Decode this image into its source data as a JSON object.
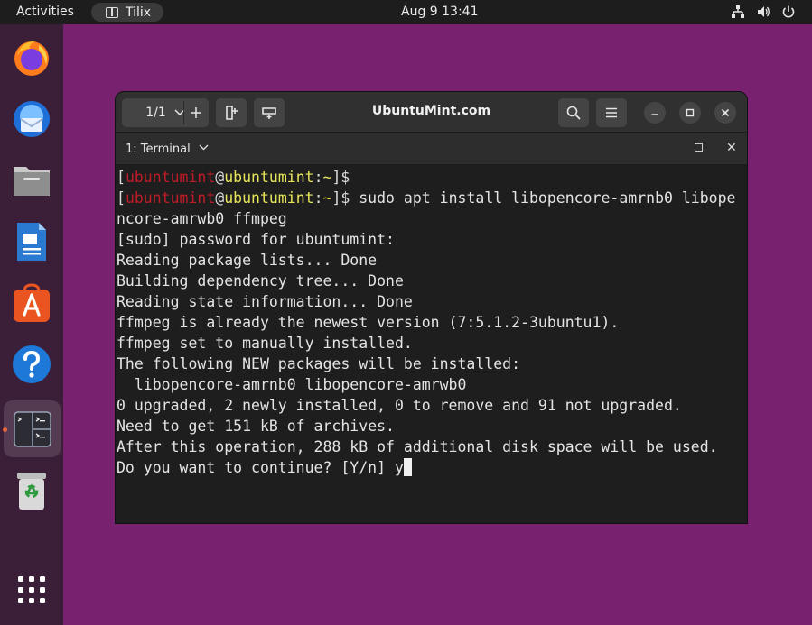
{
  "topbar": {
    "activities": "Activities",
    "app_name": "Tilix",
    "clock": "Aug 9  13:41"
  },
  "dock": {
    "items": [
      "firefox-icon",
      "thunderbird-icon",
      "files-icon",
      "libreoffice-writer-icon",
      "app-center-icon",
      "help-icon",
      "tilix-icon",
      "trash-icon",
      "show-apps-icon"
    ],
    "active": "tilix-icon"
  },
  "window": {
    "session_counter": "1/1",
    "title": "UbuntuMint.com",
    "tab_label": "1: Terminal"
  },
  "terminal": {
    "prompt": {
      "open_bracket": "[",
      "user": "ubuntumint",
      "at": "@",
      "host": "ubuntumint",
      "sep": ":",
      "path": "~",
      "close": "]$"
    },
    "command": " sudo apt install libopencore-amrnb0 libope",
    "command_wrap": "ncore-amrwb0 ffmpeg",
    "output": [
      "[sudo] password for ubuntumint:",
      "Reading package lists... Done",
      "Building dependency tree... Done",
      "Reading state information... Done",
      "ffmpeg is already the newest version (7:5.1.2-3ubuntu1).",
      "ffmpeg set to manually installed.",
      "The following NEW packages will be installed:",
      "  libopencore-amrnb0 libopencore-amrwb0",
      "0 upgraded, 2 newly installed, 0 to remove and 91 not upgraded.",
      "Need to get 151 kB of archives.",
      "After this operation, 288 kB of additional disk space will be used."
    ],
    "question": "Do you want to continue? [Y/n] y"
  }
}
